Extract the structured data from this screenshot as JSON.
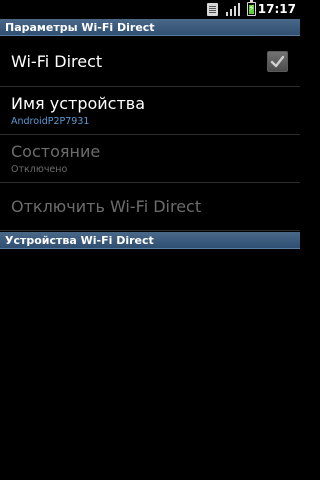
{
  "status_bar": {
    "time": "17:17",
    "icons": [
      "notification-icon",
      "signal-icon",
      "battery-charging-icon"
    ],
    "battery_color": "#5fd02f"
  },
  "header": {
    "title": "Параметры Wi-Fi Direct"
  },
  "settings": {
    "wifi_direct": {
      "label": "Wi-Fi Direct",
      "checked": true
    },
    "device_name": {
      "label": "Имя устройства",
      "value": "AndroidP2P7931"
    },
    "status": {
      "label": "Состояние",
      "value": "Отключено",
      "enabled": false
    },
    "disconnect": {
      "label": "Отключить Wi-Fi Direct",
      "enabled": false
    }
  },
  "devices_section": {
    "title": "Устройства Wi-Fi Direct"
  },
  "colors": {
    "header_bg": "#2f4f72",
    "summary_text": "#5b9bd5",
    "disabled_text": "#6c6c6c",
    "background": "#000000"
  }
}
